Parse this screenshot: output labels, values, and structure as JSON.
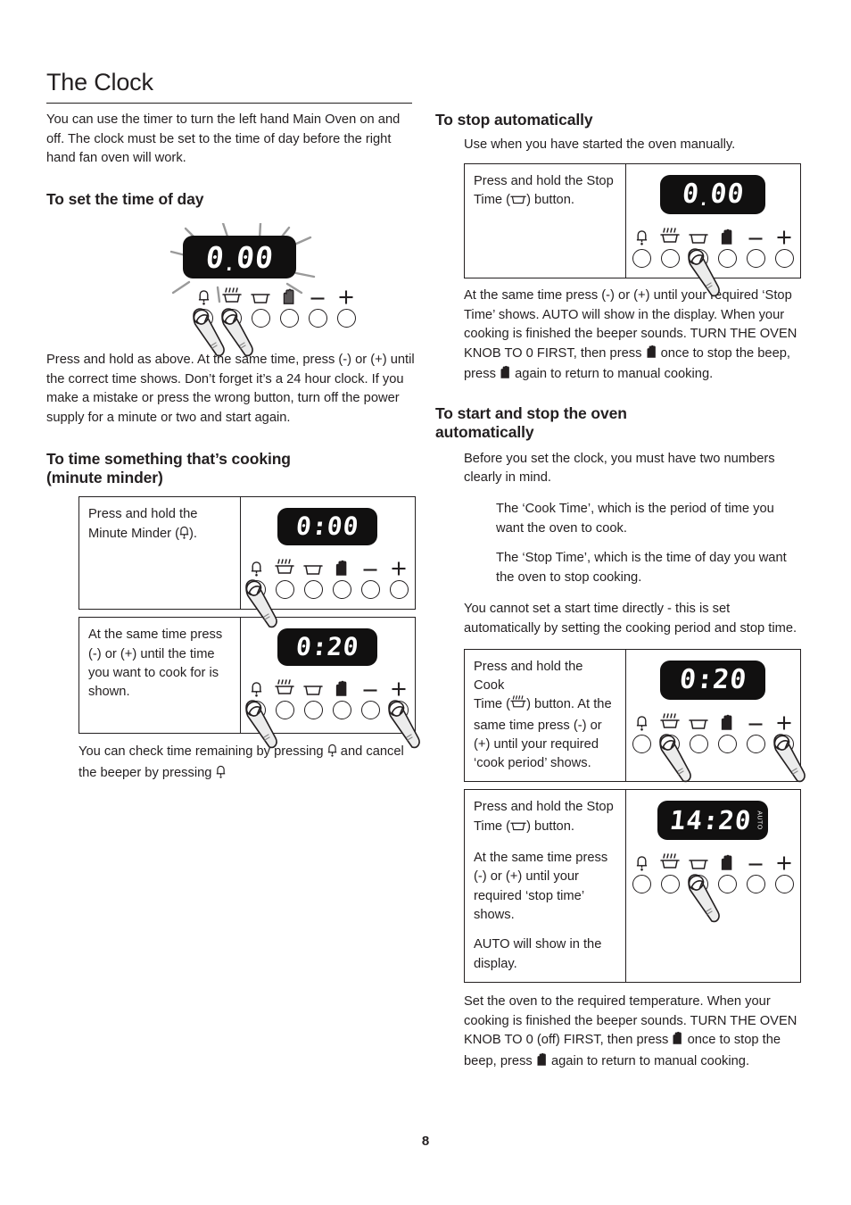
{
  "document": {
    "page_title": "The Clock",
    "page_number": "8"
  },
  "left_column": {
    "intro": "You can use the timer to turn the left hand Main Oven on and off. The clock must be set to the time of day before the right hand fan oven will work.",
    "section_set_time": {
      "heading": "To set the time of day",
      "display_value": "0.00",
      "display_separator": "low-dot",
      "flashing": true,
      "pressed_buttons": [
        "minute-minder",
        "cook-time"
      ],
      "body": "Press and hold as above. At the same time, press (-) or (+) until the correct time shows. Don’t forget it’s a 24 hour clock. If you make a mistake or press the wrong button, turn off the power supply for a minute or two and start again."
    },
    "section_minute_minder": {
      "heading_line1": "To time something that’s cooking",
      "heading_line2": "(minute minder)",
      "rows": [
        {
          "text_a": "Press and hold the",
          "text_b": "Minute Minder (",
          "text_c": ").",
          "icon": "bell-icon",
          "display_value": "0:00",
          "pressed_buttons": [
            "minute-minder"
          ]
        },
        {
          "text_a": "At the same time press (-) or (+) until the time you want to cook for is shown.",
          "display_value": "0:20",
          "pressed_buttons": [
            "minute-minder",
            "plus"
          ]
        }
      ],
      "footer_a": "You can check time remaining by pressing",
      "footer_b": "and cancel the beeper by pressing",
      "footer_icon": "bell-icon"
    }
  },
  "right_column": {
    "section_stop_auto": {
      "heading": "To stop automatically",
      "lead": "Use when you have started the oven manually.",
      "row": {
        "text_a": "Press and hold the Stop",
        "text_b": "Time (",
        "text_c": ") button.",
        "icon": "stop-time-icon",
        "display_value": "0.00",
        "display_separator": "low-dot",
        "pressed_buttons": [
          "stop-time"
        ]
      },
      "body_1": "At the same time press (-) or (+) until your required ‘Stop Time’ shows. AUTO will show in the display. When your cooking is finished the beeper sounds. TURN THE OVEN KNOB TO 0 FIRST, then press",
      "body_2": "once to stop the beep, press",
      "body_3": "again to return to manual cooking.",
      "body_icon": "manual-hand-icon"
    },
    "section_start_stop_auto": {
      "heading_line1": "To start and stop the oven",
      "heading_line2": "automatically",
      "lead": "Before you set the clock, you must have two numbers clearly in mind.",
      "bullets": [
        "The ‘Cook Time’, which is the period of time you want the oven to cook.",
        "The ‘Stop Time’, which is the time of day you want the oven to stop cooking."
      ],
      "note": "You cannot set a start time directly - this is set automatically by setting the cooking period and stop time.",
      "rows": [
        {
          "text_a": "Press and hold the Cook",
          "text_b": "Time (",
          "text_c": ") button. At the same time press (-) or (+) until your required ‘cook period’ shows.",
          "icon": "cook-time-icon",
          "display_value": "0:20",
          "pressed_buttons": [
            "cook-time",
            "plus"
          ]
        },
        {
          "text_a": "Press and hold the Stop",
          "text_b": "Time (",
          "text_c": ") button.",
          "icon": "stop-time-icon",
          "para_2": "At the same time press (-) or (+) until your required ‘stop time’ shows.",
          "para_3": "AUTO will show in the display.",
          "display_value": "14:20",
          "display_separator": "colon",
          "auto_flag": "AUTO",
          "pressed_buttons": [
            "stop-time"
          ]
        }
      ],
      "body_1": "Set the oven to the required temperature. When your cooking is finished the beeper sounds. TURN THE OVEN KNOB TO 0 (off) FIRST, then press",
      "body_2": "once to stop the beep, press",
      "body_3": "again to return to manual cooking.",
      "body_icon": "manual-hand-icon"
    }
  },
  "control_panel": {
    "icon_labels": [
      "minute-minder",
      "cook-time",
      "stop-time",
      "manual",
      "minus",
      "plus"
    ]
  },
  "colors": {
    "ink": "#231f20",
    "display_bg": "#111010",
    "display_text": "#ffffff",
    "finger_fill": "#ececec"
  }
}
